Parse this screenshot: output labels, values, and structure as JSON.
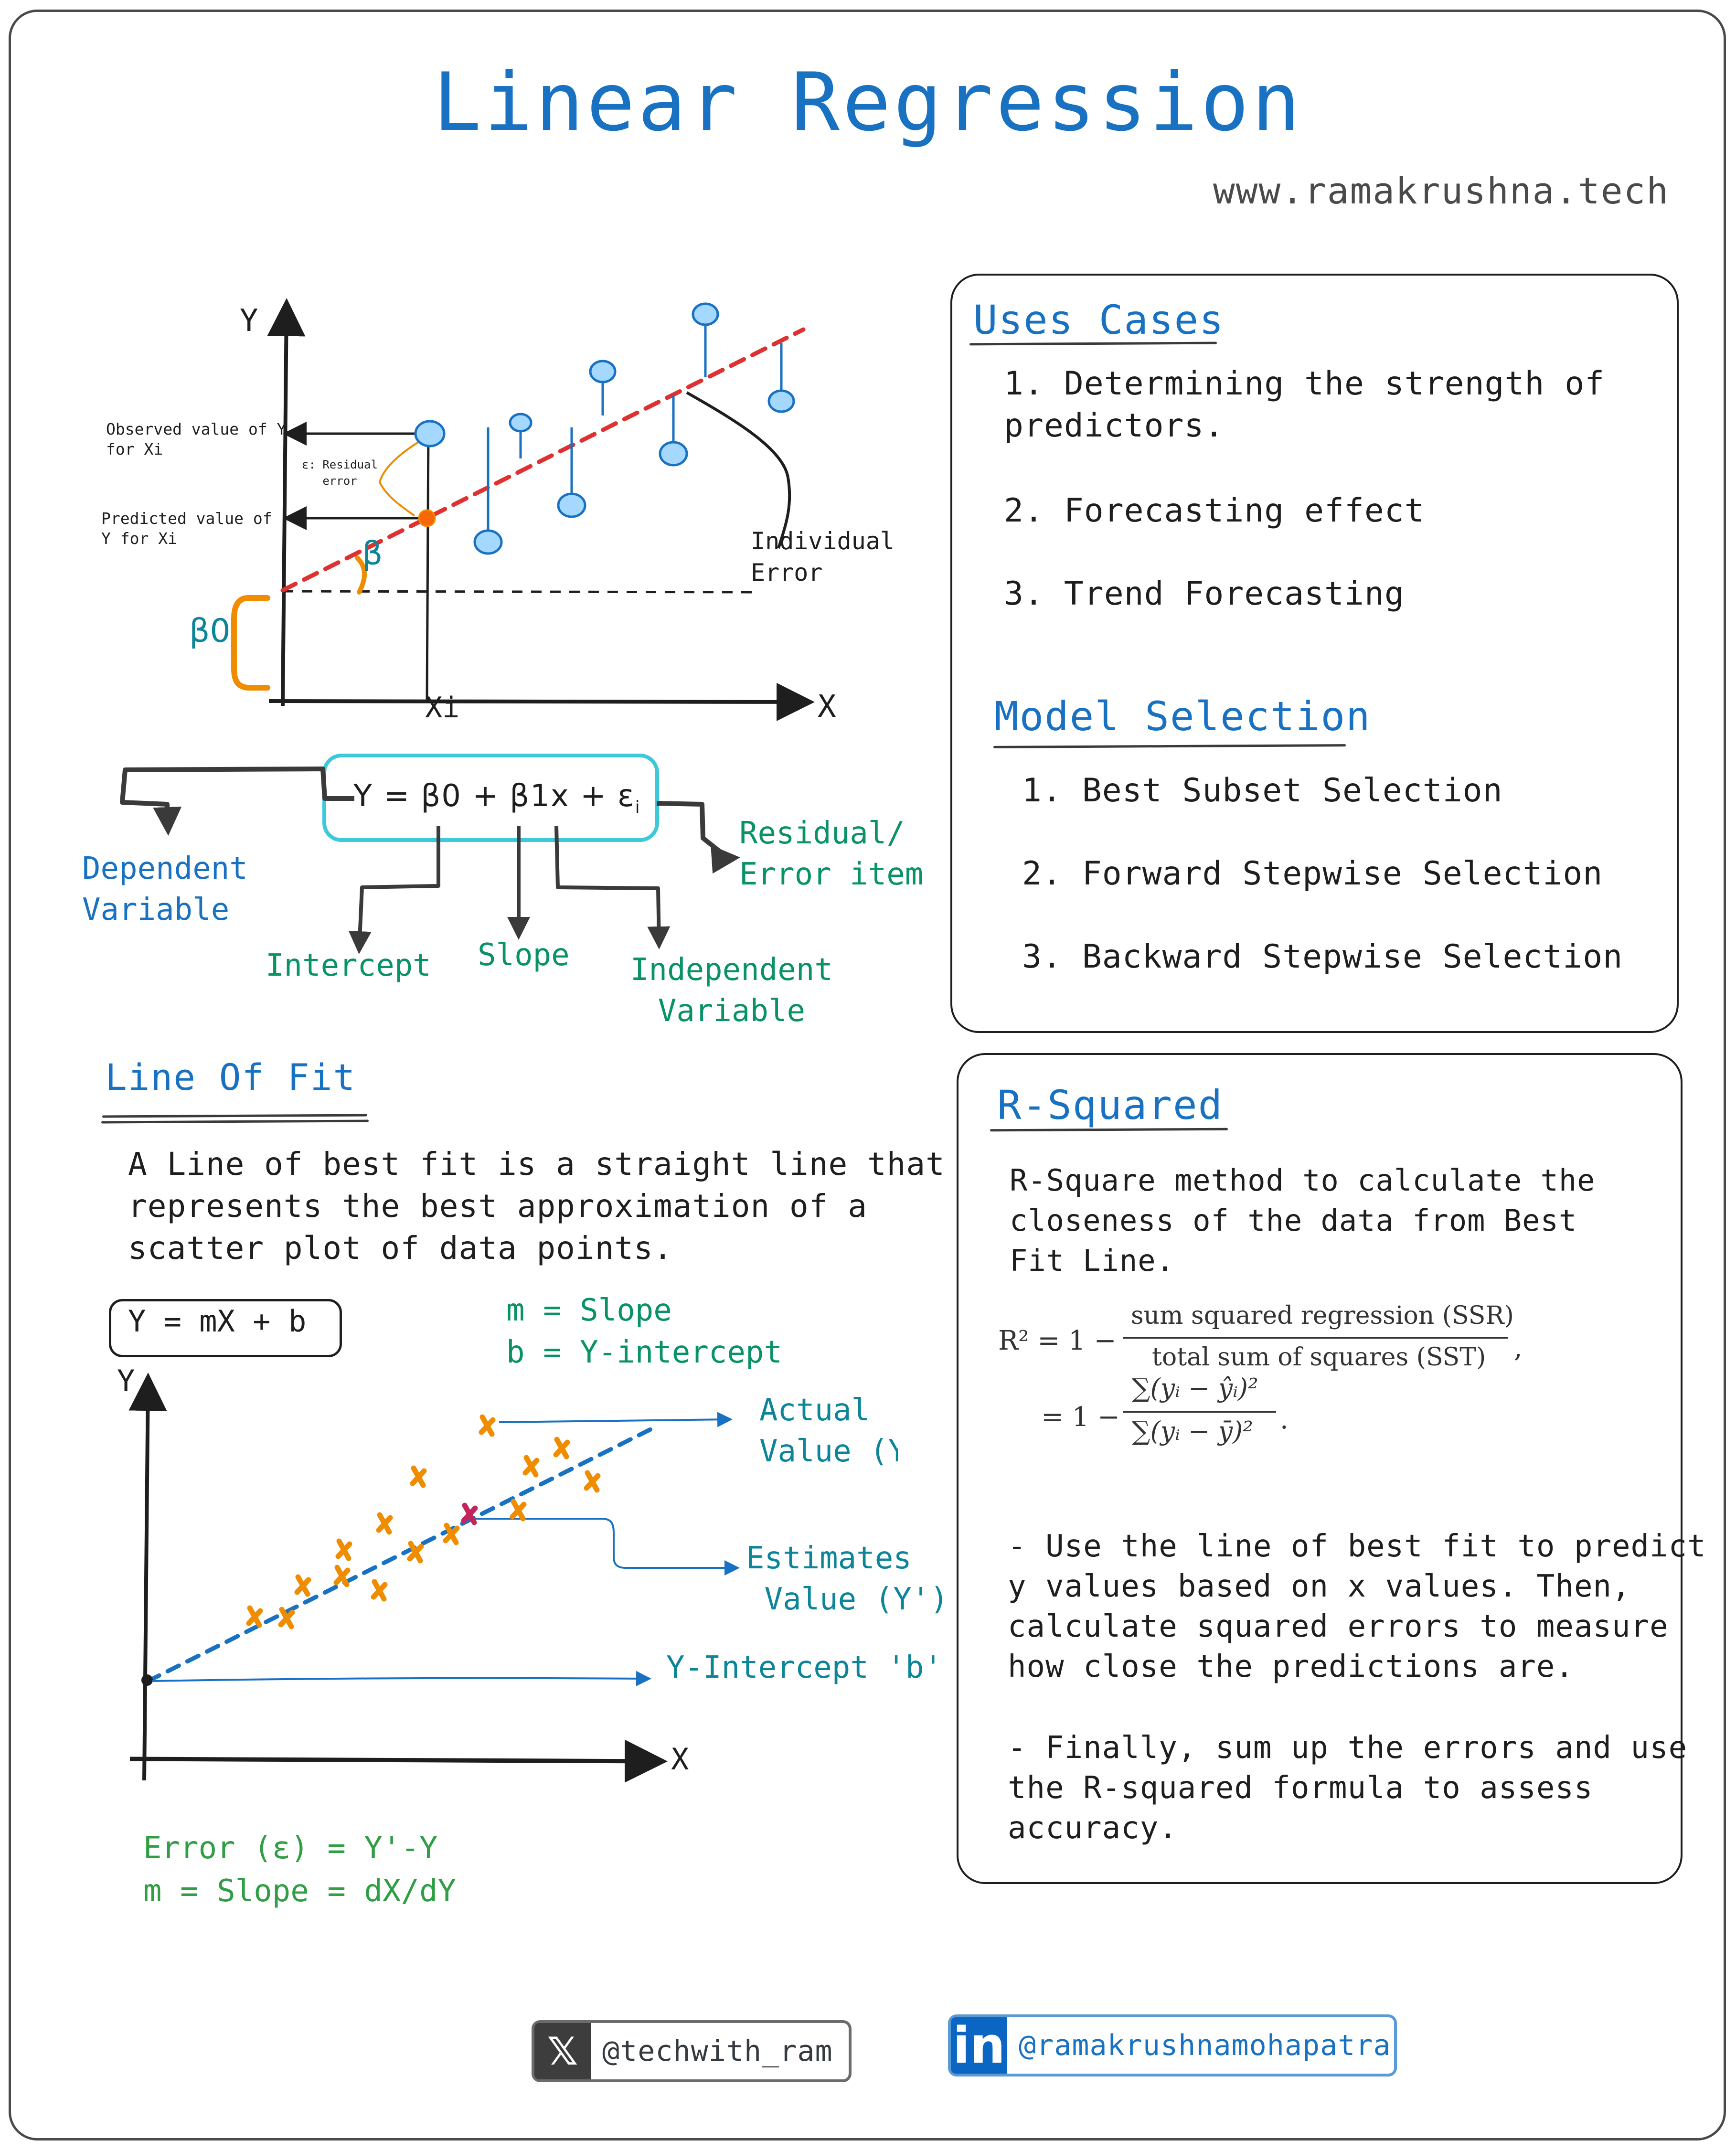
{
  "header": {
    "title": "Linear Regression",
    "website": "www.ramakrushna.tech"
  },
  "colors": {
    "title_blue": "#1971c2",
    "teal": "#0c8599",
    "green": "#099268",
    "lime_green": "#2f9e44",
    "regression_line_red": "#e03131",
    "point_fill": "#a5d8ff",
    "orange": "#f08c00",
    "estimate_marker": "#c2255c",
    "equation_box": "#3bc9db",
    "linkedin_blue": "#0a66c2"
  },
  "top_diagram": {
    "axis_y_label": "Y",
    "axis_x_label": "X",
    "xi_label": "Xi",
    "observed_label": "Observed value of Y\nfor Xi",
    "predicted_label": "Predicted value of\nY for Xi",
    "residual_label": "ε: Residual\n   error",
    "beta_label": "β",
    "beta0_label": "β0",
    "individual_error_label": "Individual\nError"
  },
  "equation": {
    "text": "Y = β0 + β1x + ε",
    "subscript": "i",
    "dependent_variable": "Dependent\nVariable",
    "intercept": "Intercept",
    "slope": "Slope",
    "independent_variable": "Independent\nVariable",
    "residual": "Residual/\nError item"
  },
  "line_of_fit": {
    "heading": "Line Of Fit",
    "description": "A Line of best fit is a straight line that\nrepresents the best approximation of a\nscatter plot of data points.",
    "formula": "Y = mX + b",
    "m_def": "m = Slope",
    "b_def": "b = Y-intercept",
    "axis_y_label": "Y",
    "axis_x_label": "X",
    "actual_value_label": "Actual\nValue (Y",
    "estimates_value_label": "Estimates\n Value (Y')",
    "y_intercept_label": "Y-Intercept 'b'",
    "error_formula": "Error (ε) = Y'-Y",
    "slope_formula": "m = Slope = dX/dY"
  },
  "use_cases": {
    "heading": "Uses Cases",
    "items": [
      "1. Determining the strength of\npredictors.",
      "2. Forecasting effect",
      "3. Trend Forecasting"
    ]
  },
  "model_selection": {
    "heading": "Model Selection",
    "items": [
      "1. Best Subset Selection",
      "2. Forward Stepwise Selection",
      "3. Backward Stepwise Selection"
    ]
  },
  "r_squared": {
    "heading": "R-Squared",
    "description": "R-Square method to calculate the\ncloseness of the data from Best\nFit Line.",
    "formula_lhs": "R² = 1 −",
    "formula_num1": "sum squared regression (SSR)",
    "formula_den1": "total sum of squares (SST)",
    "formula_eq2": "= 1 −",
    "formula_num2": "∑(yᵢ − ŷᵢ)²",
    "formula_den2": "∑(yᵢ − ȳ)²",
    "bullet1": "- Use the line of best fit to predict\ny values based on x values. Then,\ncalculate squared errors to measure\nhow close the predictions are.",
    "bullet2": "- Finally, sum up the errors and use\nthe R-squared formula to assess\naccuracy."
  },
  "footer": {
    "twitter_icon": "x-logo-icon",
    "twitter_handle": "@techwith_ram",
    "linkedin_icon": "linkedin-logo-icon",
    "linkedin_handle": "@ramakrushnamohapatra"
  }
}
